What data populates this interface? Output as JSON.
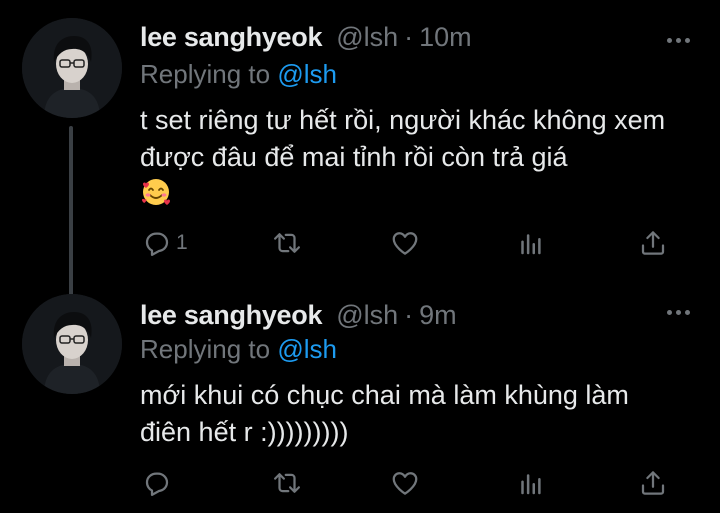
{
  "tweets": [
    {
      "author_name": "lee sanghyeok",
      "handle": "@lsh",
      "separator": "·",
      "time": "10m",
      "replying_prefix": "Replying to ",
      "replying_to": "@lsh",
      "text": "t set riêng tư hết rồi, người khác không xem được đâu để mai tỉnh rồi còn trả giá",
      "emoji": "smiling-face-with-hearts",
      "reply_count": "1",
      "retweet_count": "",
      "like_count": ""
    },
    {
      "author_name": "lee sanghyeok",
      "handle": "@lsh",
      "separator": "·",
      "time": "9m",
      "replying_prefix": "Replying to ",
      "replying_to": "@lsh",
      "text": "mới khui có chục chai mà làm khùng làm điên hết r :)))))))))",
      "reply_count": "",
      "retweet_count": "",
      "like_count": ""
    }
  ],
  "colors": {
    "background": "#000000",
    "text_primary": "#e7e9ea",
    "text_secondary": "#71767b",
    "accent": "#1d9bf0",
    "thread_line": "#3a3f44"
  }
}
